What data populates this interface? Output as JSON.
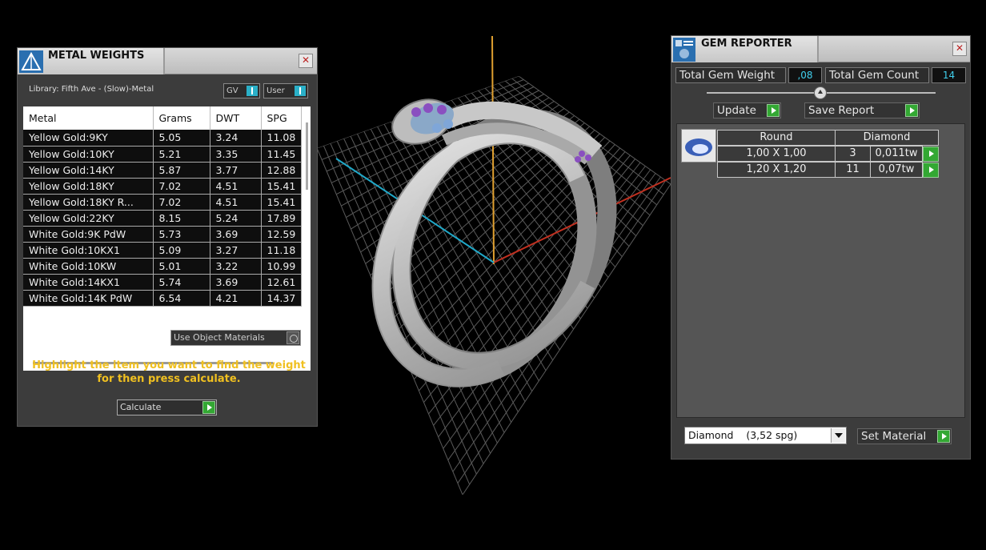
{
  "metal_weights": {
    "title": "METAL WEIGHTS",
    "close_label": "✕",
    "library_label": "Library: Fifth Ave - (Slow)-Metal",
    "toggle_gv": "GV",
    "toggle_user": "User",
    "columns": [
      "Metal",
      "Grams",
      "DWT",
      "SPG"
    ],
    "rows": [
      [
        "Yellow Gold:9KY",
        "5.05",
        "3.24",
        "11.08"
      ],
      [
        "Yellow Gold:10KY",
        "5.21",
        "3.35",
        "11.45"
      ],
      [
        "Yellow Gold:14KY",
        "5.87",
        "3.77",
        "12.88"
      ],
      [
        "Yellow Gold:18KY",
        "7.02",
        "4.51",
        "15.41"
      ],
      [
        "Yellow Gold:18KY R...",
        "7.02",
        "4.51",
        "15.41"
      ],
      [
        "Yellow Gold:22KY",
        "8.15",
        "5.24",
        "17.89"
      ],
      [
        "White Gold:9K PdW",
        "5.73",
        "3.69",
        "12.59"
      ],
      [
        "White Gold:10KX1",
        "5.09",
        "3.27",
        "11.18"
      ],
      [
        "White Gold:10KW",
        "5.01",
        "3.22",
        "10.99"
      ],
      [
        "White Gold:14KX1",
        "5.74",
        "3.69",
        "12.61"
      ],
      [
        "White Gold:14K PdW",
        "6.54",
        "4.21",
        "14.37"
      ]
    ],
    "use_object_materials": "Use Object Materials",
    "hint": "Highlight the item you want to find the weight for then press calculate.",
    "calculate_label": "Calculate"
  },
  "gem_reporter": {
    "title": "GEM REPORTER",
    "close_label": "✕",
    "total_weight_label": "Total Gem Weight",
    "total_weight_value": ",08",
    "total_count_label": "Total Gem Count",
    "total_count_value": "14",
    "update_label": "Update",
    "save_report_label": "Save Report",
    "shape": "Round",
    "gem_type": "Diamond",
    "gems": [
      {
        "size": "1,00 X 1,00",
        "count": "3",
        "weight": "0,011tw"
      },
      {
        "size": "1,20 X 1,20",
        "count": "11",
        "weight": "0,07tw"
      }
    ],
    "material_select": "Diamond    (3,52 spg)",
    "set_material_label": "Set Material"
  },
  "colors": {
    "accent_hint": "#f0c020",
    "value_cyan": "#40d0ee",
    "go_green": "#33a833",
    "axis_y": "#e0a030",
    "axis_x": "#c03020",
    "axis_z": "#20a8c8",
    "gem_purple": "#8a4fc0"
  }
}
